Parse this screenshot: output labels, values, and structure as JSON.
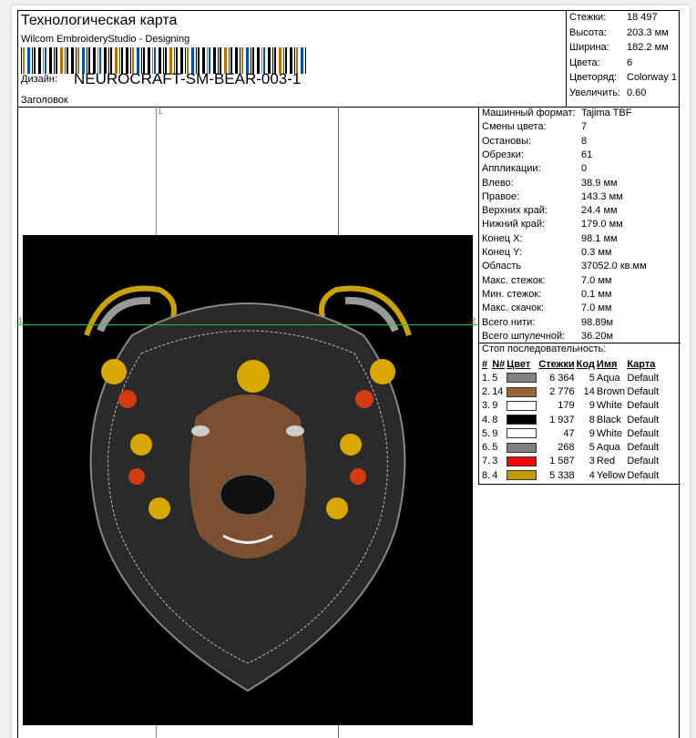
{
  "header": {
    "title": "Технологическая карта",
    "software": "Wilcom EmbroideryStudio - Designing",
    "design_label": "Дизайн:",
    "design_name": "NEUROCRAFT-SM-BEAR-003-1",
    "heading_label": "Заголовок"
  },
  "summary": [
    {
      "k": "Стежки:",
      "v": "18 497"
    },
    {
      "k": "Высота:",
      "v": "203.3 мм"
    },
    {
      "k": "Ширина:",
      "v": "182.2 мм"
    },
    {
      "k": "Цвета:",
      "v": "6"
    },
    {
      "k": "Цветоряд:",
      "v": "Colorway 1"
    },
    {
      "k": "Увеличить:",
      "v": "0.60"
    }
  ],
  "stats": [
    {
      "k": "Машинный формат:",
      "v": "Tajima TBF"
    },
    {
      "k": "Смены цвета:",
      "v": "7"
    },
    {
      "k": "Остановы:",
      "v": "8"
    },
    {
      "k": "Обрезки:",
      "v": "61"
    },
    {
      "k": "Аппликации:",
      "v": "0"
    },
    {
      "k": "Влево:",
      "v": "38.9 мм"
    },
    {
      "k": "Правое:",
      "v": "143.3 мм"
    },
    {
      "k": "Верхних край:",
      "v": "24.4 мм"
    },
    {
      "k": "Нижний край:",
      "v": "179.0 мм"
    },
    {
      "k": "Конец X:",
      "v": "98.1 мм"
    },
    {
      "k": "Конец Y:",
      "v": "0.3 мм"
    },
    {
      "k": "Область",
      "v": "37052.0 кв.мм"
    },
    {
      "k": "Макс. стежок:",
      "v": "7.0 мм"
    },
    {
      "k": "Мин. стежок:",
      "v": "0.1 мм"
    },
    {
      "k": "Макс. скачок:",
      "v": "7.0 мм"
    },
    {
      "k": "Всего нити:",
      "v": "98.89м"
    },
    {
      "k": "Всего шпулечной:",
      "v": "36.20м"
    }
  ],
  "sequence": {
    "title": "Стоп последовательность:",
    "headers": [
      "#",
      "N#",
      "Цвет",
      "Стежки",
      "Код",
      "Имя",
      "Карта"
    ],
    "rows": [
      {
        "n": "1.",
        "nn": "5",
        "color": "#808080",
        "st": "6 364",
        "code": "5",
        "name": "Aqua",
        "map": "Default"
      },
      {
        "n": "2.",
        "nn": "14",
        "color": "#9a6434",
        "st": "2 776",
        "code": "14",
        "name": "Brown",
        "map": "Default"
      },
      {
        "n": "3.",
        "nn": "9",
        "color": "#ffffff",
        "st": "179",
        "code": "9",
        "name": "White",
        "map": "Default"
      },
      {
        "n": "4.",
        "nn": "8",
        "color": "#000000",
        "st": "1 937",
        "code": "8",
        "name": "Black",
        "map": "Default"
      },
      {
        "n": "5.",
        "nn": "9",
        "color": "#ffffff",
        "st": "47",
        "code": "9",
        "name": "White",
        "map": "Default"
      },
      {
        "n": "6.",
        "nn": "5",
        "color": "#808080",
        "st": "268",
        "code": "5",
        "name": "Aqua",
        "map": "Default"
      },
      {
        "n": "7.",
        "nn": "3",
        "color": "#ff0000",
        "st": "1 587",
        "code": "3",
        "name": "Red",
        "map": "Default"
      },
      {
        "n": "8.",
        "nn": "4",
        "color": "#c09a00",
        "st": "5 338",
        "code": "4",
        "name": "Yellow",
        "map": "Default"
      }
    ]
  },
  "guides": {
    "v1": "1",
    "h1": "1",
    "h2": "2"
  }
}
